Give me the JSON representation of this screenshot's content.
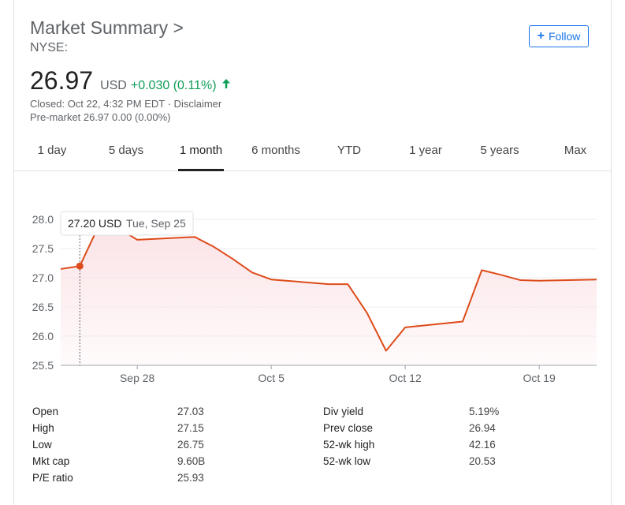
{
  "header": {
    "title": "Market Summary >",
    "exchange": "NYSE:",
    "follow_label": "Follow",
    "follow_icon": "plus-icon"
  },
  "quote": {
    "price": "26.97",
    "currency": "USD",
    "change": "+0.030 (0.11%)",
    "change_color": "#0f9d58",
    "closed_text": "Closed: Oct 22, 4:32 PM EDT · Disclaimer",
    "premarket_text": "Pre-market 26.97 0.00 (0.00%)"
  },
  "tabs": [
    {
      "label": "1 day",
      "active": false
    },
    {
      "label": "5 days",
      "active": false
    },
    {
      "label": "1 month",
      "active": true
    },
    {
      "label": "6 months",
      "active": false
    },
    {
      "label": "YTD",
      "active": false
    },
    {
      "label": "1 year",
      "active": false
    },
    {
      "label": "5 years",
      "active": false
    },
    {
      "label": "Max",
      "active": false
    }
  ],
  "chart_data": {
    "type": "area",
    "line_color": "#dd4b1a",
    "fill_color": "#fbe3e6",
    "ylim": [
      25.5,
      28.0
    ],
    "y_ticks": [
      "28.0",
      "27.5",
      "27.0",
      "26.5",
      "26.0",
      "25.5"
    ],
    "x_tick_labels": [
      "Sep 28",
      "Oct 5",
      "Oct 12",
      "Oct 19"
    ],
    "x_ticks": [
      "2018-09-28",
      "2018-10-05",
      "2018-10-12",
      "2018-10-19"
    ],
    "grid": true,
    "x": [
      "2018-09-24",
      "2018-09-25",
      "2018-09-26",
      "2018-09-27",
      "2018-09-28",
      "2018-10-01",
      "2018-10-02",
      "2018-10-03",
      "2018-10-04",
      "2018-10-05",
      "2018-10-08",
      "2018-10-09",
      "2018-10-10",
      "2018-10-11",
      "2018-10-12",
      "2018-10-15",
      "2018-10-16",
      "2018-10-17",
      "2018-10-18",
      "2018-10-19",
      "2018-10-22"
    ],
    "values": [
      27.15,
      27.2,
      27.9,
      27.85,
      27.65,
      27.7,
      27.53,
      27.32,
      27.09,
      26.97,
      26.89,
      26.89,
      26.4,
      25.75,
      26.15,
      26.25,
      27.13,
      27.05,
      26.96,
      26.95,
      26.97
    ],
    "tooltip": {
      "price": "27.20 USD",
      "date": "Tue, Sep 25",
      "x": "2018-09-25",
      "y": 27.2
    }
  },
  "stats": {
    "left": [
      {
        "label": "Open",
        "value": "27.03"
      },
      {
        "label": "High",
        "value": "27.15"
      },
      {
        "label": "Low",
        "value": "26.75"
      },
      {
        "label": "Mkt cap",
        "value": "9.60B"
      },
      {
        "label": "P/E ratio",
        "value": "25.93"
      }
    ],
    "right": [
      {
        "label": "Div yield",
        "value": "5.19%"
      },
      {
        "label": "Prev close",
        "value": "26.94"
      },
      {
        "label": "52-wk high",
        "value": "42.16"
      },
      {
        "label": "52-wk low",
        "value": "20.53"
      }
    ]
  }
}
